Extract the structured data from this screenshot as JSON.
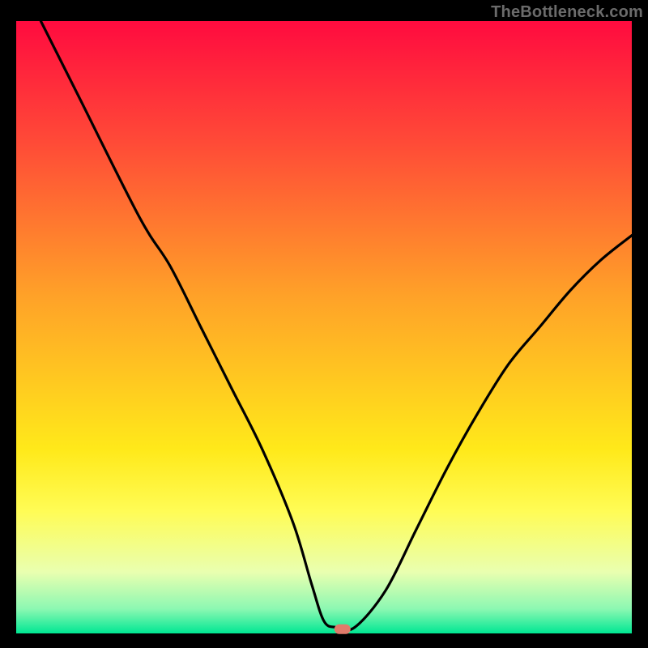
{
  "watermark": "TheBottleneck.com",
  "marker": {
    "color": "#e07a6a"
  },
  "chart_data": {
    "type": "line",
    "title": "",
    "xlabel": "",
    "ylabel": "",
    "xlim": [
      0,
      100
    ],
    "ylim": [
      0,
      100
    ],
    "grid": false,
    "legend": false,
    "series": [
      {
        "name": "curve",
        "x": [
          4,
          10,
          20,
          25,
          30,
          35,
          40,
          45,
          48,
          50,
          52,
          55,
          60,
          65,
          70,
          75,
          80,
          85,
          90,
          95,
          100
        ],
        "y": [
          100,
          88,
          68,
          60,
          50,
          40,
          30,
          18,
          8,
          2,
          1,
          1,
          7,
          17,
          27,
          36,
          44,
          50,
          56,
          61,
          65
        ]
      }
    ],
    "marker_point": {
      "x": 53,
      "y": 0.7
    },
    "gradient_stops": [
      {
        "offset": 0.0,
        "color": "#ff0b3f"
      },
      {
        "offset": 0.2,
        "color": "#ff4b37"
      },
      {
        "offset": 0.45,
        "color": "#ffa228"
      },
      {
        "offset": 0.7,
        "color": "#ffe91a"
      },
      {
        "offset": 0.8,
        "color": "#fffc55"
      },
      {
        "offset": 0.9,
        "color": "#e9ffb0"
      },
      {
        "offset": 0.96,
        "color": "#8cf8b2"
      },
      {
        "offset": 1.0,
        "color": "#00e793"
      }
    ]
  }
}
